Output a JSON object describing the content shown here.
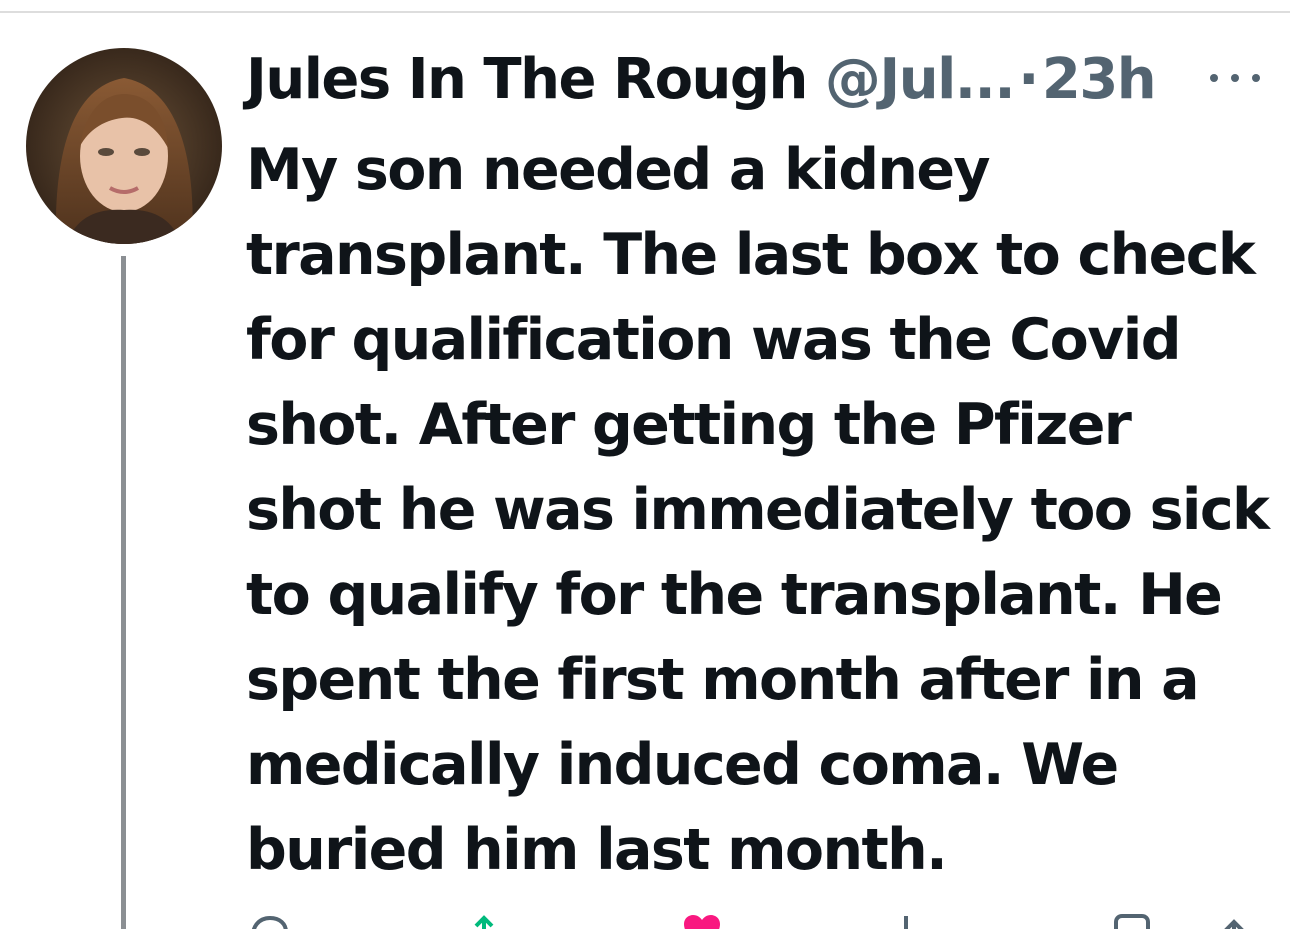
{
  "tweet": {
    "display_name": "Jules In The Rough",
    "handle": "@Jul...",
    "separator": "·",
    "time": "23h",
    "text": "My son needed a kidney\ntransplant. The last box to check\nfor qualification was the Covid\nshot. After getting the Pfizer\nshot he was immediately too sick\nto qualify for the transplant. He\nspent the first month after in a\nmedically induced coma. We\nburied him last month."
  },
  "icons": {
    "more": "more-horizontal-icon",
    "reply": "reply-icon",
    "retweet": "retweet-icon",
    "like": "heart-icon",
    "views": "views-icon",
    "bookmark": "bookmark-icon",
    "share": "share-icon"
  },
  "colors": {
    "text_primary": "#0f1419",
    "text_secondary": "#536471",
    "retweet_green": "#00ba7c",
    "like_pink": "#f91880"
  }
}
